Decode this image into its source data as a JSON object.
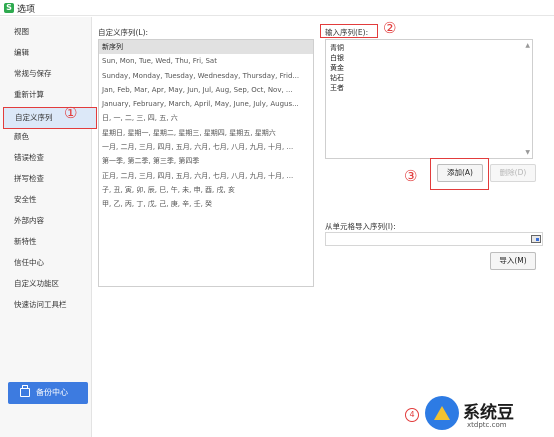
{
  "window": {
    "title": "选项",
    "app_icon_glyph": "S"
  },
  "sidebar": {
    "items": [
      {
        "label": "视图"
      },
      {
        "label": "编辑"
      },
      {
        "label": "常规与保存"
      },
      {
        "label": "重新计算"
      },
      {
        "label": "自定义序列",
        "active": true
      },
      {
        "label": "颜色"
      },
      {
        "label": "错误检查"
      },
      {
        "label": "拼写检查"
      },
      {
        "label": "安全性"
      },
      {
        "label": "外部内容"
      },
      {
        "label": "新特性"
      },
      {
        "label": "信任中心"
      },
      {
        "label": "自定义功能区"
      },
      {
        "label": "快速访问工具栏"
      }
    ],
    "backup_button": "备份中心"
  },
  "custom_lists": {
    "label": "自定义序列(L):",
    "items": [
      "新序列",
      "Sun, Mon, Tue, Wed, Thu, Fri, Sat",
      "Sunday, Monday, Tuesday, Wednesday, Thursday, Frid...",
      "Jan, Feb, Mar, Apr, May, Jun, Jul, Aug, Sep, Oct, Nov, ...",
      "January, February, March, April, May, June, July, Augus...",
      "日, 一, 二, 三, 四, 五, 六",
      "星期日, 星期一, 星期二, 星期三, 星期四, 星期五, 星期六",
      "一月, 二月, 三月, 四月, 五月, 六月, 七月, 八月, 九月, 十月, ...",
      "第一季, 第二季, 第三季, 第四季",
      "正月, 二月, 三月, 四月, 五月, 六月, 七月, 八月, 九月, 十月, ...",
      "子, 丑, 寅, 卯, 辰, 巳, 午, 未, 申, 酉, 戌, 亥",
      "甲, 乙, 丙, 丁, 戊, 己, 庚, 辛, 壬, 癸"
    ]
  },
  "input_sequence": {
    "label": "输入序列(E):",
    "lines": [
      "青铜",
      "白银",
      "黄金",
      "钻石",
      "王者"
    ]
  },
  "buttons": {
    "add": "添加(A)",
    "delete": "删除(D)",
    "import": "导入(M)"
  },
  "import": {
    "label": "从单元格导入序列(I):",
    "value": ""
  },
  "annotations": {
    "n1": "①",
    "n2": "②",
    "n3": "③",
    "n4": "4"
  },
  "watermark": {
    "text": "系统豆",
    "url": "xtdptc.com"
  },
  "colors": {
    "annotation_red": "#e23c3c",
    "accent_blue": "#3d7be0",
    "selected_bg": "#dce8f8"
  }
}
